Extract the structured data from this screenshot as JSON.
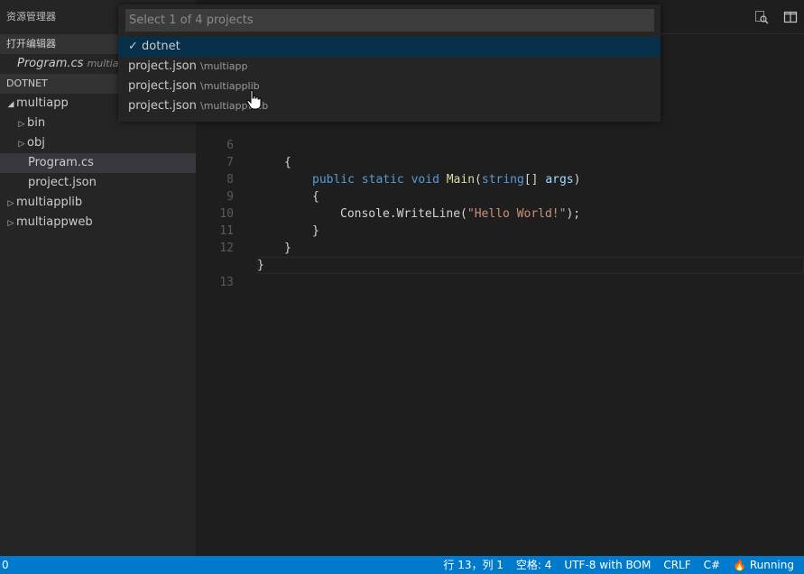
{
  "sidebar": {
    "title": "资源管理器",
    "open_editors_header": "打开编辑器",
    "open_editor": {
      "name": "Program.cs",
      "desc": "multiapp"
    },
    "workspace_header": "DOTNET",
    "tree": [
      {
        "label": "multiapp",
        "twistie": "◢"
      },
      {
        "label": "bin",
        "twistie": "▷"
      },
      {
        "label": "obj",
        "twistie": "▷"
      },
      {
        "label": "Program.cs",
        "twistie": ""
      },
      {
        "label": "project.json",
        "twistie": ""
      },
      {
        "label": "multiapplib",
        "twistie": "▷"
      },
      {
        "label": "multiappweb",
        "twistie": "▷"
      }
    ]
  },
  "quickpick": {
    "placeholder": "Select 1 of 4 projects",
    "items": [
      {
        "label": "✓ dotnet",
        "desc": ""
      },
      {
        "label": "project.json",
        "desc": "\\multiapp"
      },
      {
        "label": "project.json",
        "desc": "\\multiapplib"
      },
      {
        "label": "project.json",
        "desc": "\\multiappweb"
      }
    ]
  },
  "editor": {
    "line_numbers": [
      "6",
      "7",
      "8",
      "9",
      "10",
      "11",
      "12",
      "13"
    ],
    "code": {
      "l6": "{",
      "l7_kw1": "public",
      "l7_kw2": "static",
      "l7_kw3": "void",
      "l7_fn": "Main",
      "l7_p1": "(",
      "l7_ty": "string",
      "l7_p2": "[]",
      "l7_pa": "args",
      "l7_p3": ")",
      "l8": "{",
      "l9_a": "Console.WriteLine(",
      "l9_str": "\"Hello World!\"",
      "l9_b": ");",
      "l10": "}",
      "l11": "}",
      "l12": "}"
    }
  },
  "statusbar": {
    "left": "0",
    "position": "行 13，列 1",
    "spaces": "空格: 4",
    "encoding": "UTF-8 with BOM",
    "eol": "CRLF",
    "language": "C#",
    "running": "🔥 Running"
  }
}
